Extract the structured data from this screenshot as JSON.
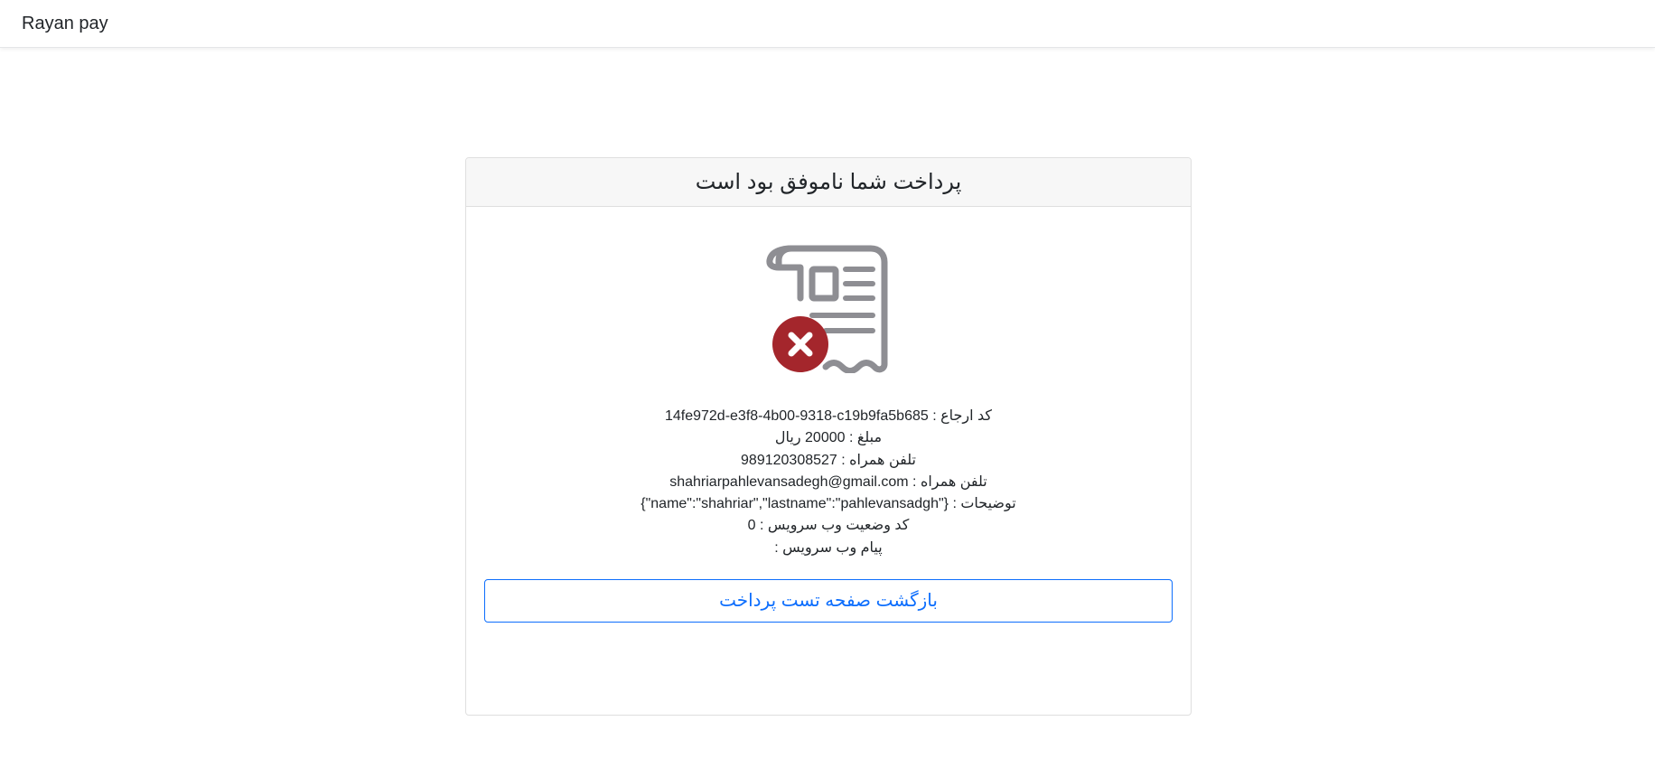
{
  "navbar": {
    "brand": "Rayan pay"
  },
  "card": {
    "title": "پرداخت شما ناموفق بود است",
    "icon": "receipt-failed-icon",
    "colors": {
      "icon_gray": "#8e8e93",
      "error_red": "#a4262c",
      "button_blue": "#0d6efd"
    },
    "details": [
      {
        "label": "کد ارجاع : ",
        "value": "14fe972d-e3f8-4b00-9318-c19b9fa5b685"
      },
      {
        "label": "مبلغ : ",
        "value": "20000 ریال"
      },
      {
        "label": "تلفن همراه : ",
        "value": "989120308527"
      },
      {
        "label": "تلفن همراه : ",
        "value": "shahriarpahlevansadegh@gmail.com"
      },
      {
        "label": "توضیحات : ",
        "value": "{\"name\":\"shahriar\",\"lastname\":\"pahlevansadgh\"}"
      },
      {
        "label": "کد وضعیت وب سرویس : ",
        "value": "0"
      },
      {
        "label": "پیام وب سرویس : ",
        "value": ""
      }
    ],
    "back_button": "بازگشت صفحه تست پرداخت"
  }
}
